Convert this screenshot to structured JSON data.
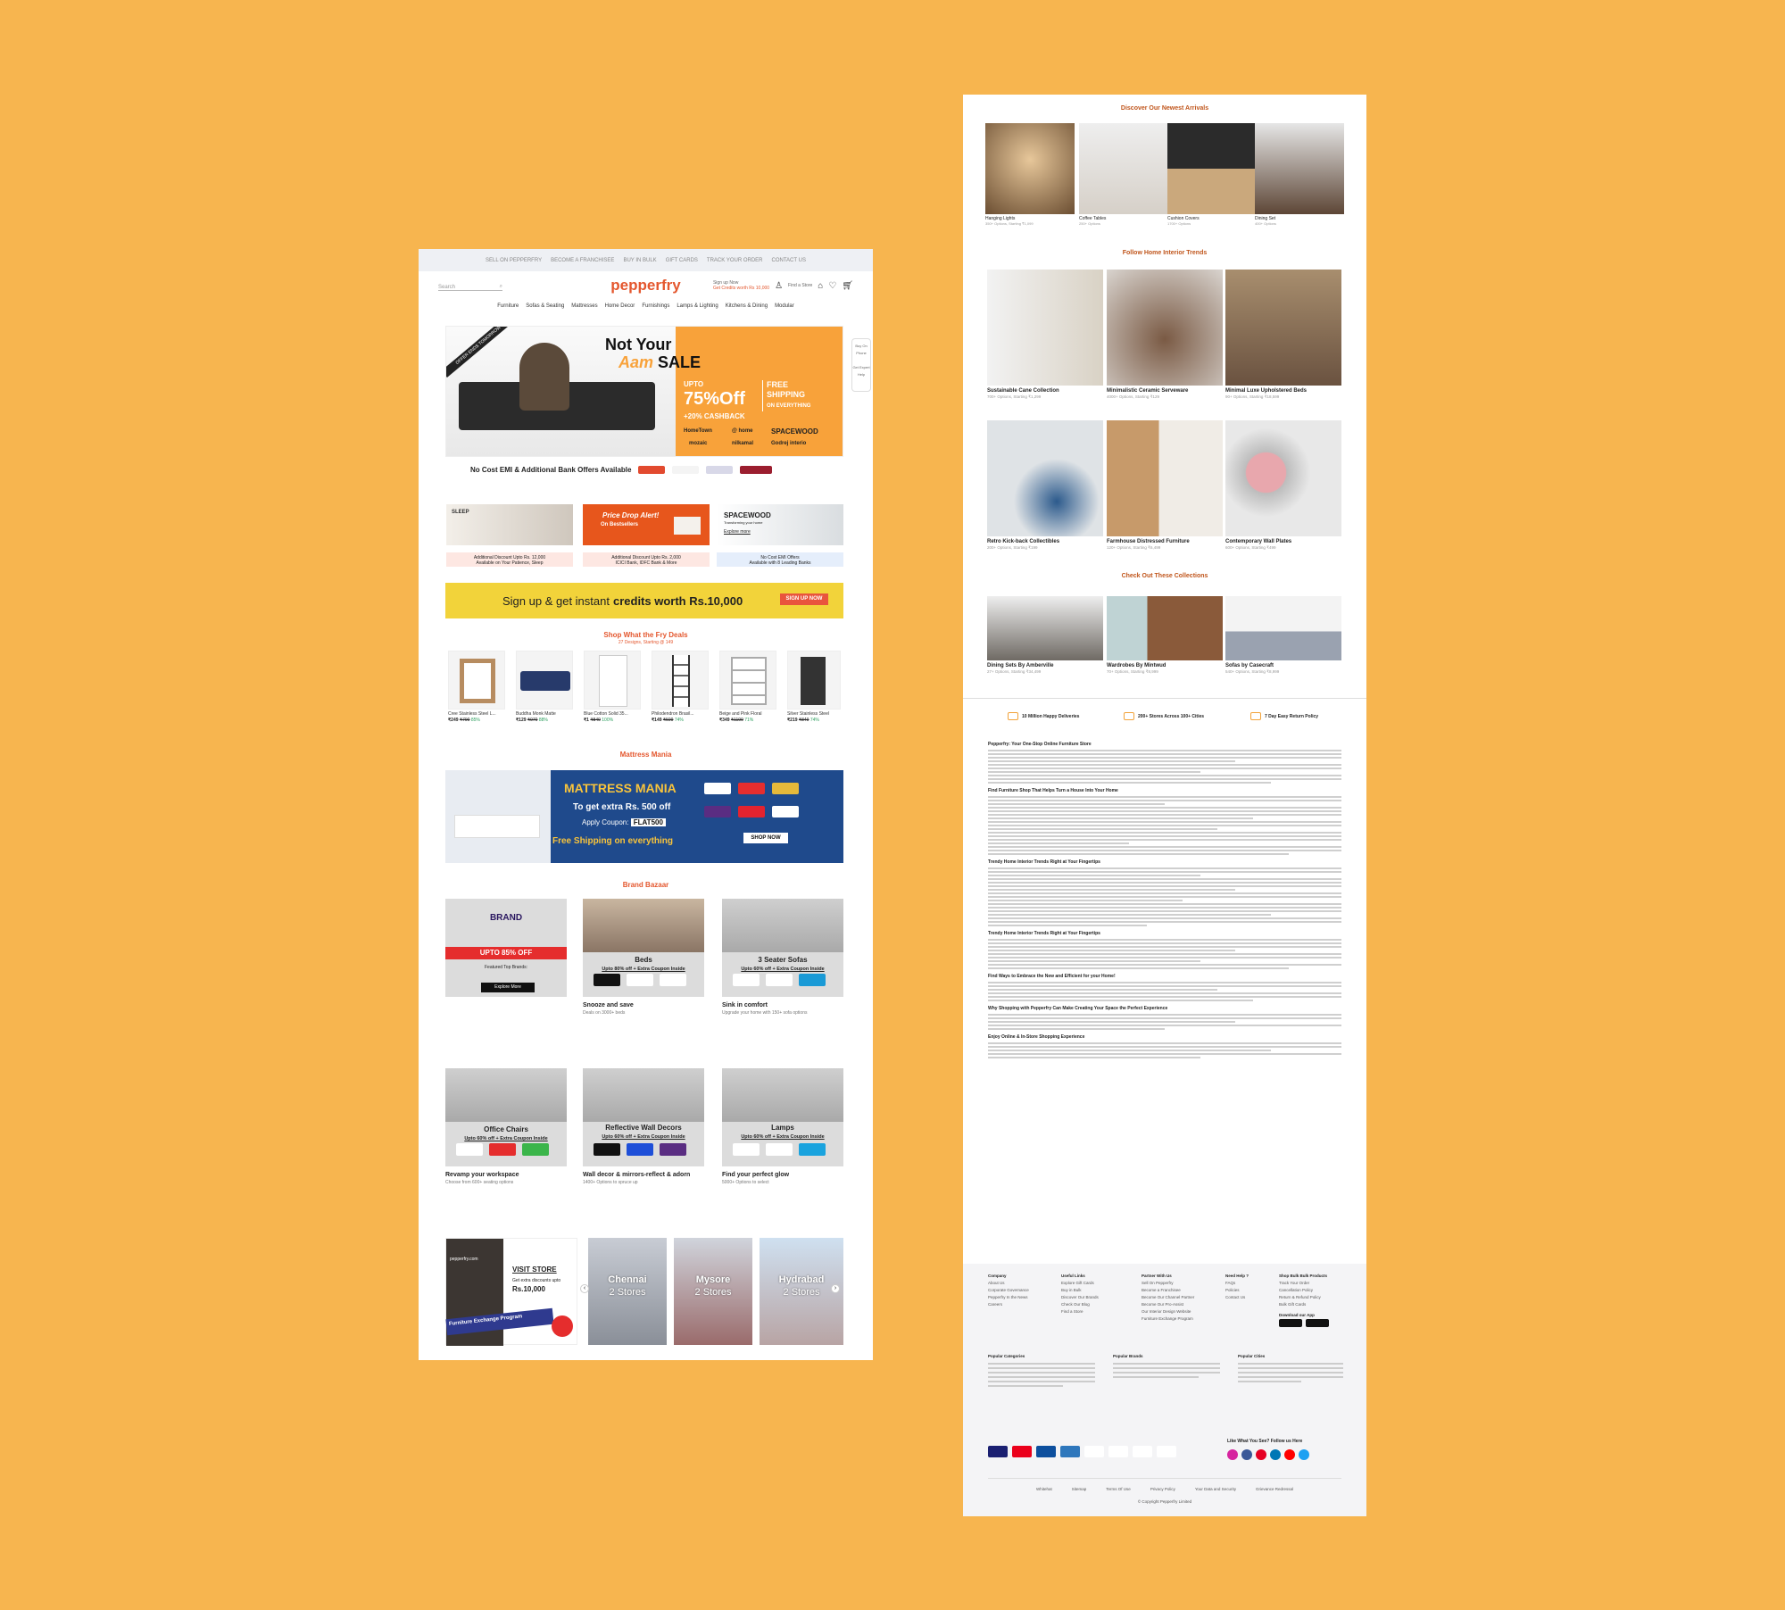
{
  "left": {
    "topbar": [
      "SELL ON PEPPERFRY",
      "BECOME A FRANCHISEE",
      "BUY IN BULK",
      "GIFT CARDS",
      "TRACK YOUR ORDER",
      "CONTACT US"
    ],
    "search_placeholder": "Search",
    "logo": "pepperfry",
    "header": {
      "signup": "Sign up Now",
      "signup_sub": "Get Credits worth Rs 10,000",
      "find_store": "Find a Store"
    },
    "nav": [
      "Furniture",
      "Sofas & Seating",
      "Mattresses",
      "Home Decor",
      "Furnishings",
      "Lamps & Lighting",
      "Kitchens & Dining",
      "Modular"
    ],
    "hero": {
      "ribbon": "OFFER ENDS TOMORROW",
      "t1": "Not Your",
      "t2": "Aam",
      "t3": "SALE",
      "upto": "UPTO",
      "off": "75%Off",
      "cashback": "+20% CASHBACK",
      "free": "FREE",
      "shipping": "SHIPPING",
      "everything": "ON EVERYTHING",
      "b1": "HomeTown",
      "b2": "@ home",
      "b3": "SPACEWOOD",
      "b4": "mozaic",
      "b5": "nilkamal",
      "b6": "Godrej interio"
    },
    "emi": "No Cost EMI & Additional Bank Offers Available",
    "side": {
      "s1": "Buy On Phone",
      "s2": "Get Expert Help"
    },
    "tiles": [
      {
        "title": "SLEEP",
        "caption": "Additional Discount Upto Rs. 12,000",
        "cap2": "Available on Your Patience, Sleep"
      },
      {
        "title": "Price Drop Alert!",
        "sub": "On Bestsellers",
        "caption": "Additional Discount Upto Rs. 2,000",
        "cap2": "ICICI Bank, IDFC Bank & More"
      },
      {
        "title": "SPACEWOOD",
        "sub": "Transforming your home",
        "cta": "Explore more",
        "caption": "No Cost EMI Offers",
        "cap2": "Available with 8 Leading Banks"
      }
    ],
    "signup": {
      "text": "Sign up & get instant",
      "bold": "credits worth Rs.10,000",
      "btn": "SIGN UP NOW"
    },
    "deals_title": "Shop What the Fry Deals",
    "deals_sub": "27 Designs, Starting @ 149",
    "deals": [
      {
        "name": "Cree Stainless Steel L...",
        "price": "₹249",
        "old": "₹790",
        "disc": "85%"
      },
      {
        "name": "Buddha Monk Matte",
        "price": "₹129",
        "old": "₹970",
        "disc": "88%"
      },
      {
        "name": "Blue Cotton Solid 35...",
        "price": "₹1",
        "old": "₹849",
        "disc": "100%"
      },
      {
        "name": "Philodendron Brasil...",
        "price": "₹149",
        "old": "₹599",
        "disc": "74%"
      },
      {
        "name": "Beige and Pink Floral",
        "price": "₹349",
        "old": "₹1199",
        "disc": "71%"
      },
      {
        "name": "Silver Stainless Steel",
        "price": "₹219",
        "old": "₹849",
        "disc": "74%"
      }
    ],
    "mm_title": "Mattress Mania",
    "mm": {
      "title": "MATTRESS MANIA",
      "line1": "To get extra Rs. 500 off",
      "apply": "Apply Coupon:",
      "code": "FLAT500",
      "free": "Free Shipping on everything",
      "btn": "SHOP NOW"
    },
    "bb_title": "Brand Bazaar",
    "bb": [
      {
        "title": "BRAND",
        "sub": "UPTO 85% OFF",
        "feat": "Featured Top Brands:",
        "btn": "Explore More"
      },
      {
        "title": "Beds",
        "sub": "Upto 80% off + Extra Coupon Inside",
        "l1": "Snooze and save",
        "l2": "Deals on 3000+ beds"
      },
      {
        "title": "3 Seater Sofas",
        "sub": "Upto 60% off + Extra Coupon Inside",
        "l1": "Sink in comfort",
        "l2": "Upgrade your home with 150+ sofa options"
      },
      {
        "title": "Office Chairs",
        "sub": "Upto 60% off + Extra Coupon Inside",
        "l1": "Revamp your workspace",
        "l2": "Choose from 600+ seating options"
      },
      {
        "title": "Reflective Wall Decors",
        "sub": "Upto 60% off + Extra Coupon Inside",
        "l1": "Wall decor & mirrors-reflect & adorn",
        "l2": "1400+ Options to spruce up"
      },
      {
        "title": "Lamps",
        "sub": "Upto 60% off + Extra Coupon Inside",
        "l1": "Find your perfect glow",
        "l2": "5000+ Options to select"
      }
    ],
    "stores": [
      {
        "name": "pepperfry.com",
        "visit": "VISIT STORE",
        "disc": "Get extra discounts upto",
        "amt": "Rs.10,000",
        "prog": "Furniture Exchange Program"
      },
      {
        "name": "Chennai",
        "count": "2 Stores"
      },
      {
        "name": "Mysore",
        "count": "2 Stores"
      },
      {
        "name": "Hydrabad",
        "count": "2 Stores"
      }
    ]
  },
  "right": {
    "arrivals_title": "Discover Our Newest Arrivals",
    "arrivals": [
      {
        "name": "Hanging Lights",
        "sub": "350+ Options, Starting ₹1,099"
      },
      {
        "name": "Coffee Tables",
        "sub": "250+ Options"
      },
      {
        "name": "Cushion Covers",
        "sub": "1700+ Options"
      },
      {
        "name": "Dining Set",
        "sub": "400+ Options"
      }
    ],
    "trends_title": "Follow Home Interior Trends",
    "trends": [
      {
        "name": "Sustainable Cane Collection",
        "sub": "700+ Options, Starting ₹1,299"
      },
      {
        "name": "Minimalistic Ceramic Serveware",
        "sub": "4000+ Options, Starting ₹129"
      },
      {
        "name": "Minimal Luxe Upholstered Beds",
        "sub": "90+ Options, Starting ₹18,599"
      },
      {
        "name": "Retro Kick-back Collectibles",
        "sub": "200+ Options, Starting ₹199"
      },
      {
        "name": "Farmhouse Distressed Furniture",
        "sub": "120+ Options, Starting ₹6,499"
      },
      {
        "name": "Contemporary Wall Plates",
        "sub": "600+ Options, Starting ₹499"
      }
    ],
    "coll_title": "Check Out These Collections",
    "collections": [
      {
        "name": "Dining Sets By Amberville",
        "sub": "27+ Options, Starting ₹34,499"
      },
      {
        "name": "Wardrobes By Mintwud",
        "sub": "70+ Options, Starting ₹8,999"
      },
      {
        "name": "Sofas by Casecraft",
        "sub": "540+ Options, Starting ₹8,999"
      }
    ],
    "features": [
      "10 Million Happy Deliveries",
      "200+ Stores Across 100+ Cities",
      "7 Day Easy Return Policy"
    ],
    "headings": [
      "Pepperfry: Your One-Stop Online Furniture Store",
      "Find Furniture Shop That Helps Turn a House Into Your Home",
      "Trendy Home Interior Trends Right at Your Fingertips",
      "Trendy Home Interior Trends Right at Your Fingertips",
      "Find Ways to Embrace the New and Efficient for your Home!",
      "Why Shopping with Pepperfry Can Make Creating Your Space the Perfect Experience",
      "Enjoy Online & In-Store Shopping Experience"
    ],
    "footer": {
      "cols": [
        {
          "title": "Company",
          "items": [
            "About Us",
            "Corporate Governance",
            "Pepperfry In the News",
            "Careers"
          ]
        },
        {
          "title": "Useful Links",
          "items": [
            "Explore Gift Cards",
            "Buy in Bulk",
            "Discover Our Brands",
            "Check Our Blog",
            "Find a Store"
          ]
        },
        {
          "title": "Partner With Us",
          "items": [
            "Sell On Pepperfry",
            "Become a Franchisee",
            "Become Our Channel Partner",
            "Become Our Pro-Assist",
            "Our Interior Design Website",
            "Furniture Exchange Program"
          ]
        },
        {
          "title": "Need Help ?",
          "items": [
            "FAQs",
            "Policies",
            "Contact Us"
          ]
        },
        {
          "title": "Shop Bulk Bulk Products",
          "items": [
            "Track Your Order",
            "Cancellation Policy",
            "Return & Refund Policy",
            "Bulk Gift Cards"
          ]
        }
      ],
      "app": "Download our App",
      "pop_cats": "Popular Categories",
      "pop_brands": "Popular Brands",
      "pop_cities": "Popular Cities",
      "like": "Like What You See? Follow us Here",
      "links": [
        "Whitehat",
        "Sitemap",
        "Terms Of Use",
        "Privacy Policy",
        "Your Data and Security",
        "Grievance Redressal"
      ],
      "copy": "© Copyright Pepperfry Limited"
    }
  }
}
